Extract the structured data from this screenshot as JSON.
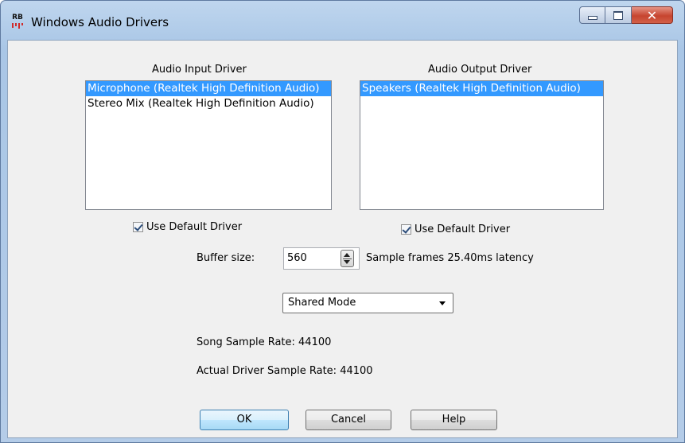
{
  "window": {
    "title": "Windows Audio Drivers",
    "app_icon_text": "RB"
  },
  "input": {
    "heading": "Audio Input Driver",
    "items": [
      "Microphone (Realtek High Definition Audio)",
      "Stereo Mix (Realtek High Definition Audio)"
    ],
    "selected_index": 0,
    "use_default_label": "Use Default Driver",
    "use_default_checked": true
  },
  "output": {
    "heading": "Audio Output Driver",
    "items": [
      "Speakers (Realtek High Definition Audio)"
    ],
    "selected_index": 0,
    "use_default_label": "Use Default Driver",
    "use_default_checked": true
  },
  "buffer": {
    "label": "Buffer size:",
    "value": "560",
    "info": "Sample frames 25.40ms latency"
  },
  "mode": {
    "selected": "Shared Mode"
  },
  "rates": {
    "song": "Song Sample Rate: 44100",
    "driver": "Actual Driver Sample Rate: 44100"
  },
  "buttons": {
    "ok": "OK",
    "cancel": "Cancel",
    "help": "Help"
  },
  "icons": {
    "close": "close-icon",
    "minimize": "minimize-icon",
    "maximize": "maximize-icon"
  }
}
